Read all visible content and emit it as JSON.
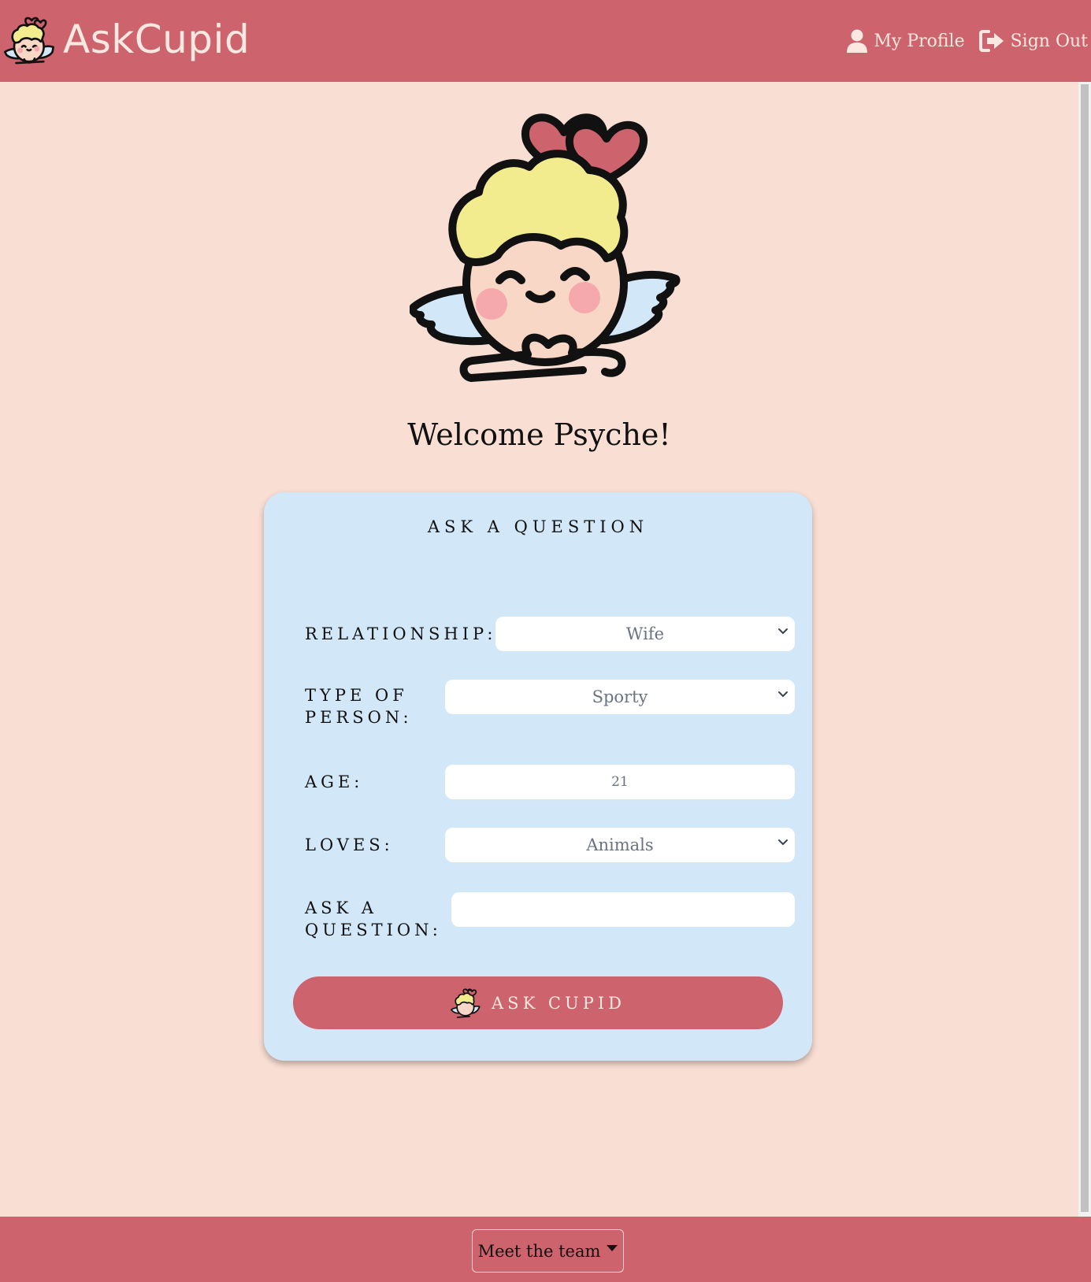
{
  "navbar": {
    "brand": "AskCupid",
    "links": [
      {
        "label": "My Profile",
        "icon": "user-icon"
      },
      {
        "label": "Sign Out",
        "icon": "sign-out-icon"
      }
    ]
  },
  "hero": {
    "image": "cupid-illustration",
    "welcome": "Welcome Psyche!"
  },
  "form": {
    "title": "ASK A QUESTION",
    "relationship": {
      "label": "RELATIONSHIP:",
      "value": "Wife"
    },
    "type_of_person": {
      "label": "TYPE OF PERSON:",
      "label_line1": "TYPE OF",
      "label_line2": "PERSON:",
      "value": "Sporty"
    },
    "age": {
      "label": "AGE:",
      "value": "21"
    },
    "loves": {
      "label": "LOVES:",
      "value": "Animals"
    },
    "question": {
      "label": "ASK A QUESTION:",
      "label_line1": "ASK A",
      "label_line2": "QUESTION:",
      "value": ""
    },
    "submit_label": "ASK CUPID"
  },
  "footer": {
    "team_button": "Meet the team"
  },
  "colors": {
    "brand": "#cc636d",
    "background": "#f8ded3",
    "card": "#d2e7f8"
  }
}
